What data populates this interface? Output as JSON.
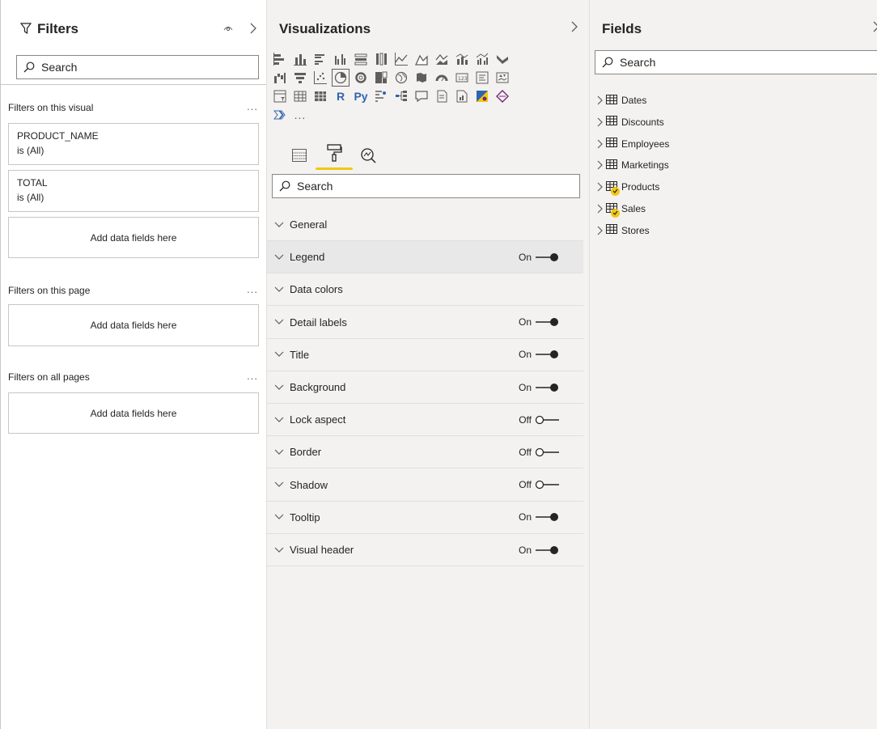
{
  "filters": {
    "title": "Filters",
    "search_placeholder": "Search",
    "on_visual_label": "Filters on this visual",
    "visual_cards": [
      {
        "name": "PRODUCT_NAME",
        "value": "is (All)"
      },
      {
        "name": "TOTAL",
        "value": "is (All)"
      }
    ],
    "add_fields_label": "Add data fields here",
    "on_page_label": "Filters on this page",
    "on_all_label": "Filters on all pages",
    "more": "..."
  },
  "visualizations": {
    "title": "Visualizations",
    "more": "...",
    "search_placeholder": "Search",
    "r_label": "R",
    "py_label": "Py",
    "format_rows": [
      {
        "label": "General",
        "toggle": ""
      },
      {
        "label": "Legend",
        "toggle": "On"
      },
      {
        "label": "Data colors",
        "toggle": ""
      },
      {
        "label": "Detail labels",
        "toggle": "On"
      },
      {
        "label": "Title",
        "toggle": "On"
      },
      {
        "label": "Background",
        "toggle": "On"
      },
      {
        "label": "Lock aspect",
        "toggle": "Off"
      },
      {
        "label": "Border",
        "toggle": "Off"
      },
      {
        "label": "Shadow",
        "toggle": "Off"
      },
      {
        "label": "Tooltip",
        "toggle": "On"
      },
      {
        "label": "Visual header",
        "toggle": "On"
      }
    ],
    "accent_color": "#f2c811"
  },
  "fields": {
    "title": "Fields",
    "search_placeholder": "Search",
    "tables": [
      {
        "name": "Dates",
        "checked": false
      },
      {
        "name": "Discounts",
        "checked": false
      },
      {
        "name": "Employees",
        "checked": false
      },
      {
        "name": "Marketings",
        "checked": false
      },
      {
        "name": "Products",
        "checked": true
      },
      {
        "name": "Sales",
        "checked": true
      },
      {
        "name": "Stores",
        "checked": false
      }
    ]
  }
}
